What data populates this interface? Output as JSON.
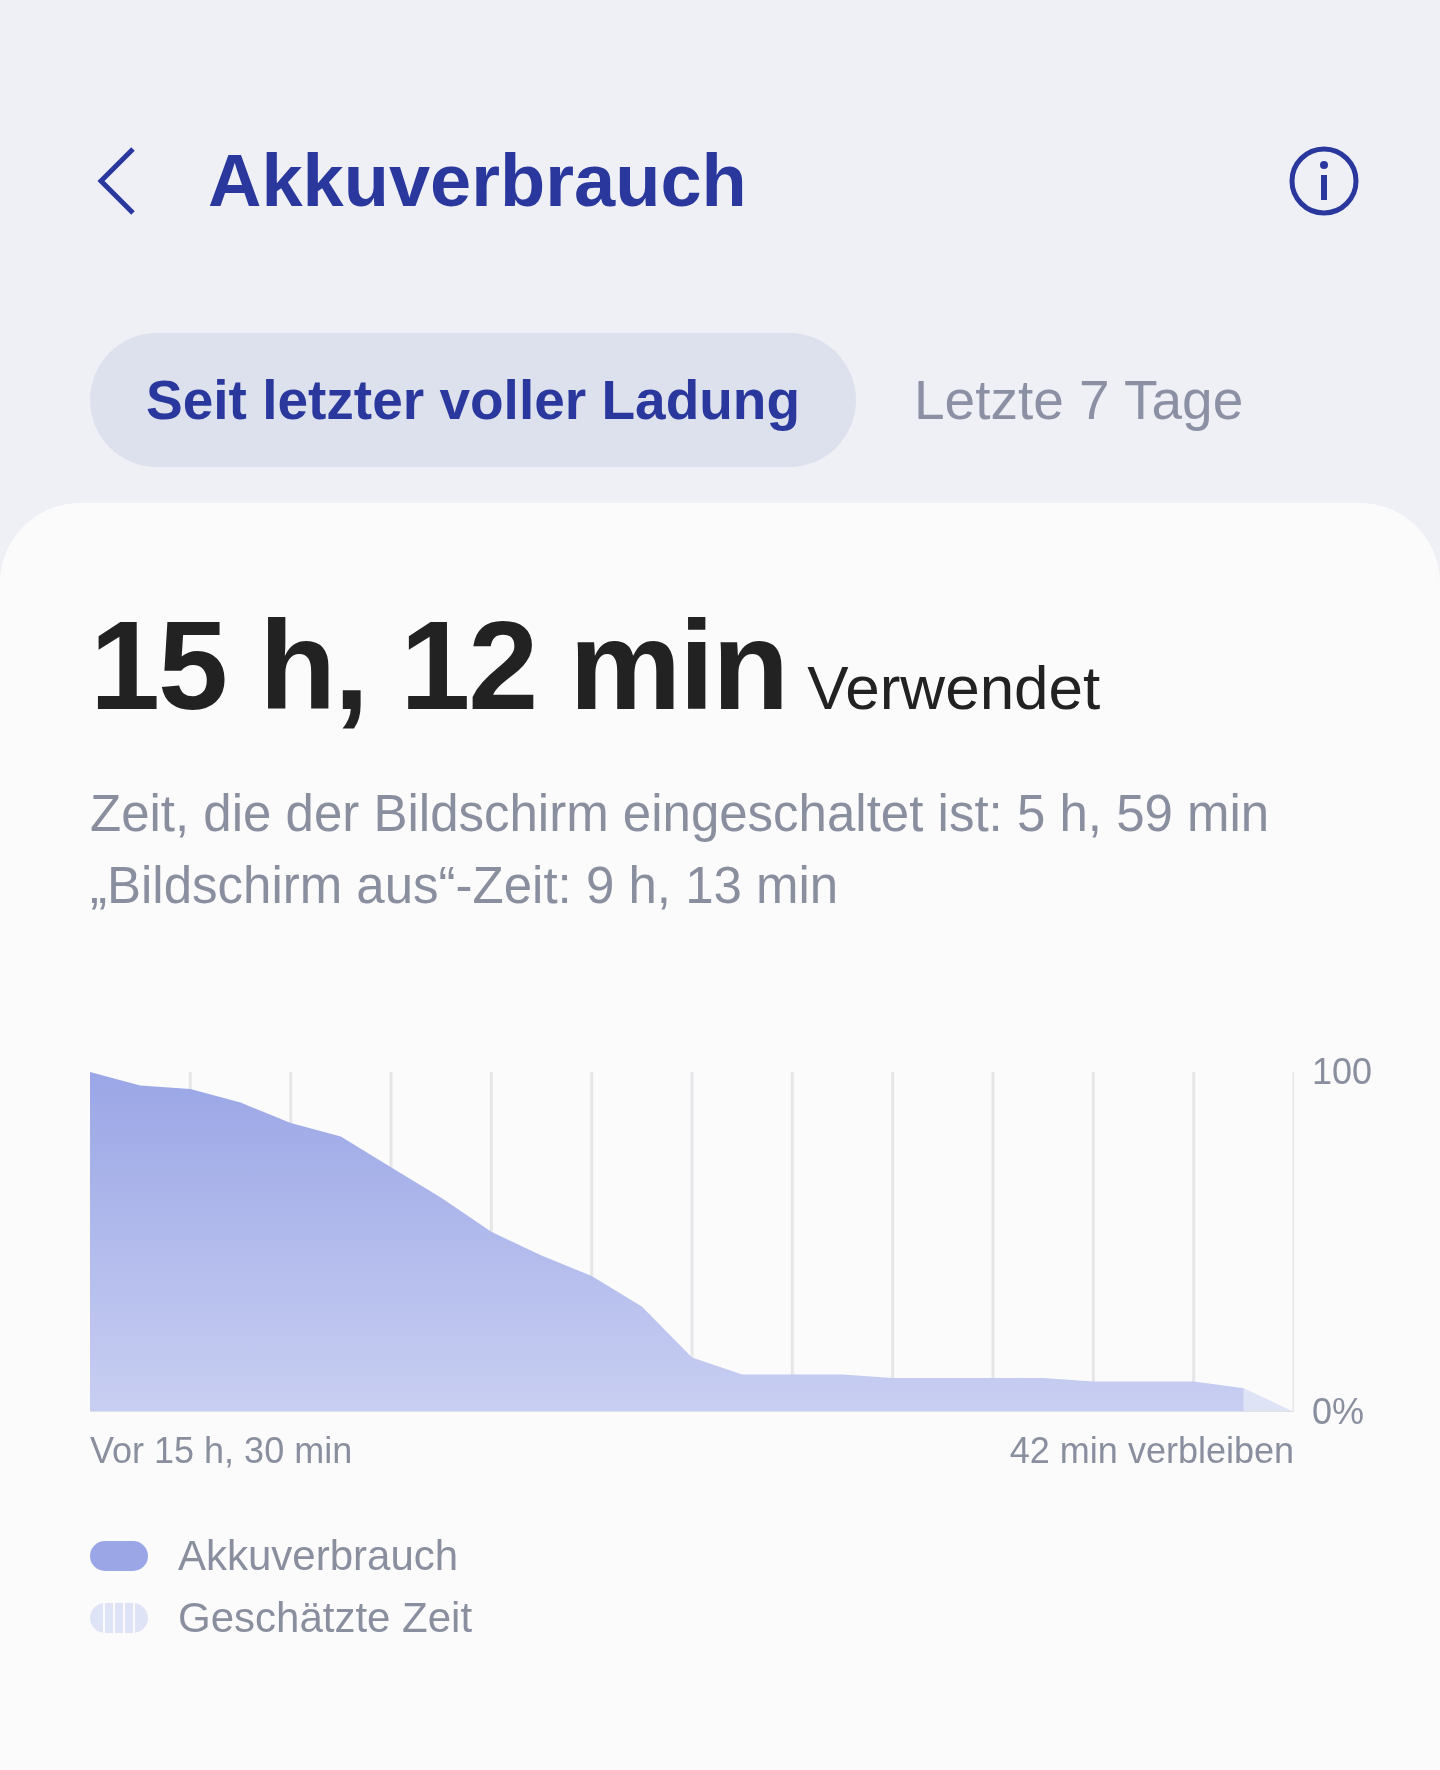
{
  "header": {
    "title": "Akkuverbrauch"
  },
  "tabs": [
    {
      "label": "Seit letzter voller Ladung",
      "selected": true
    },
    {
      "label": "Letzte 7 Tage",
      "selected": false
    }
  ],
  "summary": {
    "value": "15 h, 12 min",
    "unit": "Verwendet",
    "details": [
      "Zeit, die der Bildschirm eingeschaltet ist: 5 h, 59 min",
      "„Bildschirm aus“-Zeit: 9 h, 13 min"
    ]
  },
  "chart_data": {
    "type": "area",
    "categories": [
      null,
      null,
      null,
      null,
      null,
      null,
      null,
      null,
      null,
      null,
      null,
      null,
      null,
      null,
      null,
      null,
      null,
      null,
      null,
      null,
      null,
      null,
      null,
      null,
      null
    ],
    "series": [
      {
        "name": "Akkuverbrauch",
        "color": "#9aa6e6",
        "values": [
          100,
          96,
          95,
          91,
          85,
          81,
          72,
          63,
          53,
          46,
          40,
          31,
          16,
          11,
          11,
          11,
          10,
          10,
          10,
          10,
          9,
          9,
          9,
          7,
          null
        ]
      },
      {
        "name": "Geschätzte Zeit",
        "color": "#dfe3f6",
        "values": [
          null,
          null,
          null,
          null,
          null,
          null,
          null,
          null,
          null,
          null,
          null,
          null,
          null,
          null,
          null,
          null,
          null,
          null,
          null,
          null,
          null,
          null,
          null,
          7,
          0
        ]
      }
    ],
    "ylim": [
      0,
      100
    ],
    "grid": true,
    "yticks": [
      {
        "value": 100,
        "label": "100"
      },
      {
        "value": 0,
        "label": "0%"
      }
    ]
  },
  "chart_time_labels": {
    "start": "Vor 15 h, 30 min",
    "end": "42 min verbleiben"
  }
}
